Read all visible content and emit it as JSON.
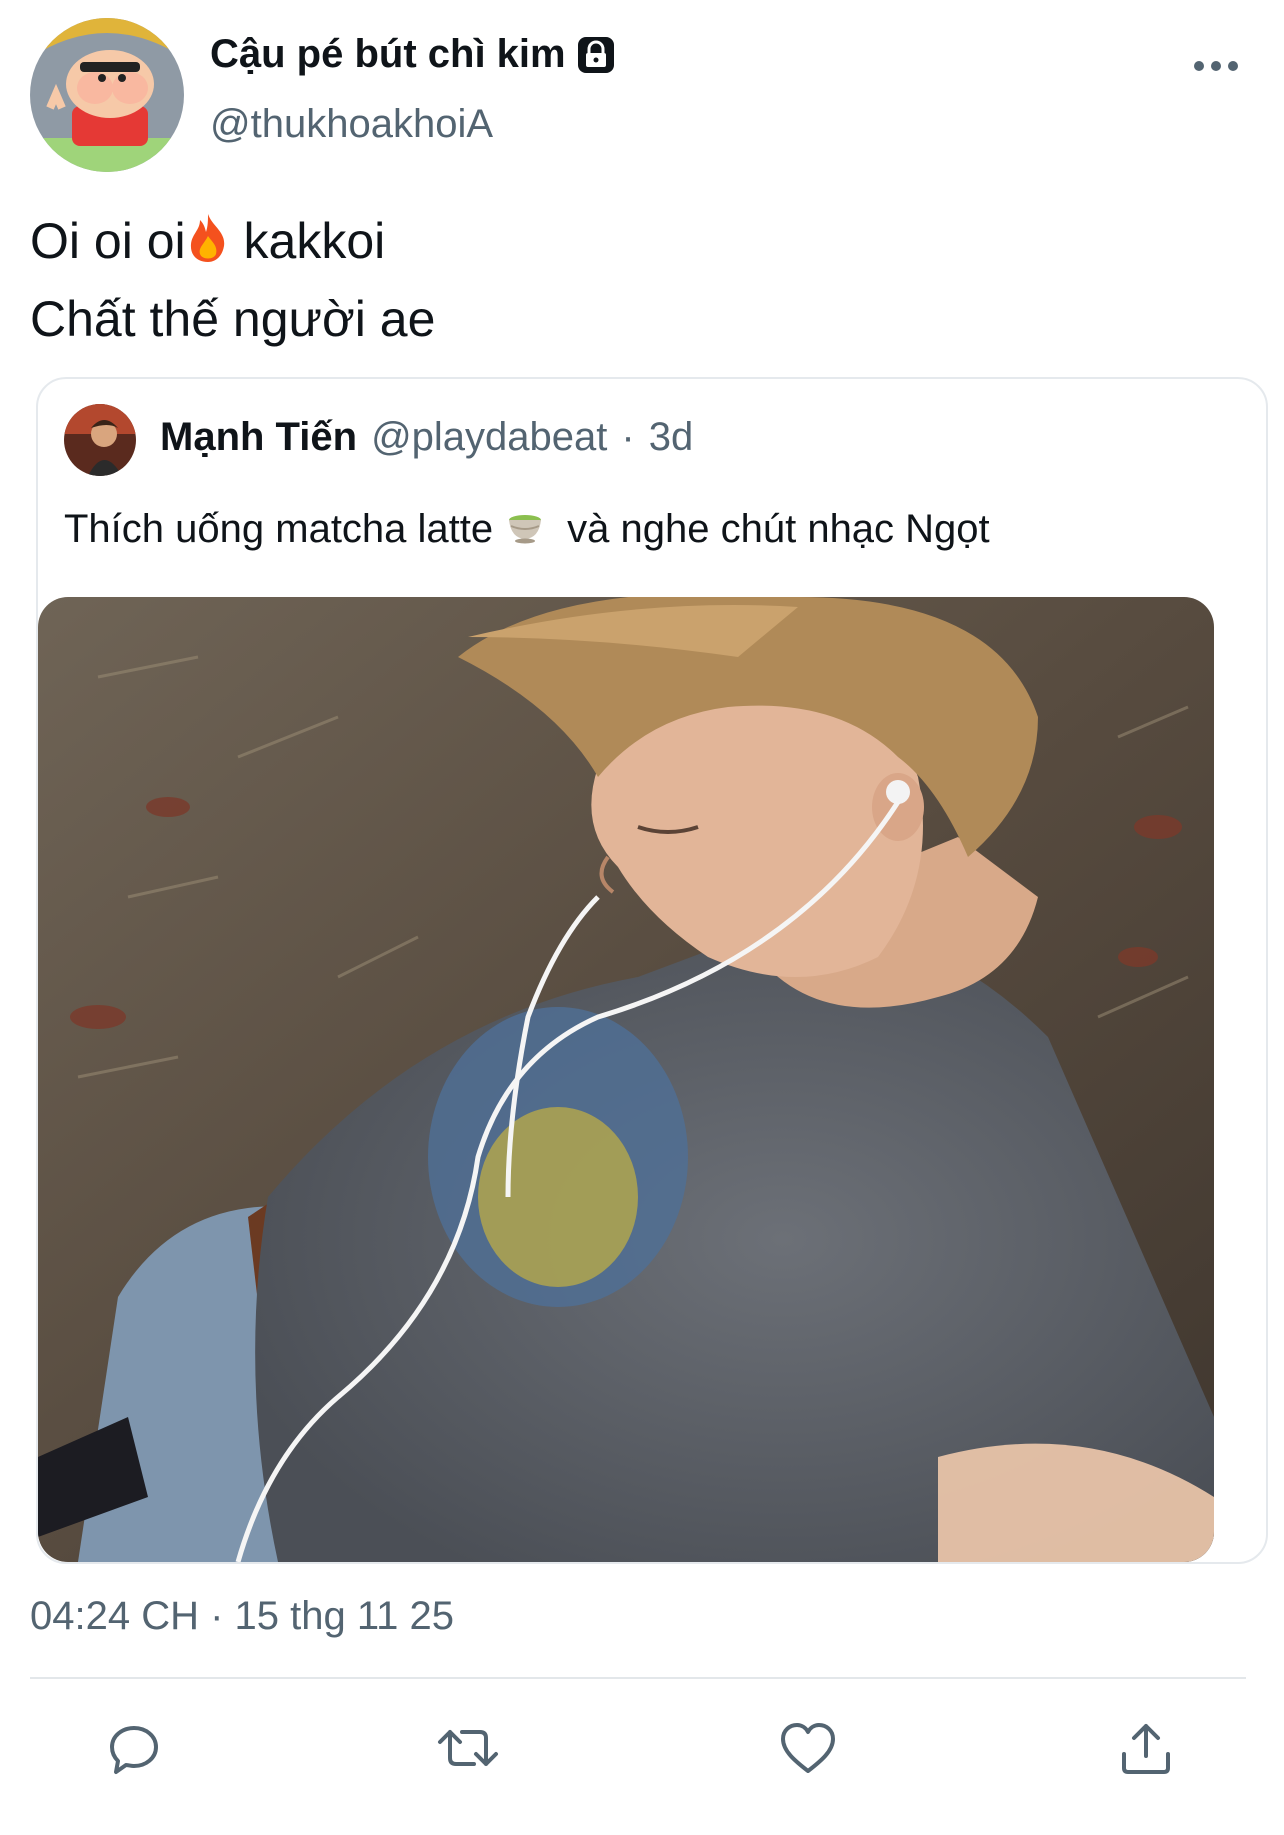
{
  "author": {
    "display_name": "Cậu pé bút chì kim",
    "handle": "@thukhoakhoiA",
    "protected_icon": "lock-icon",
    "avatar_icon": "cartoon-avatar"
  },
  "tweet": {
    "line1_before": "Oi oi oi",
    "line1_emoji": "fire",
    "line1_after": "kakkoi",
    "line2": "Chất thế người ae"
  },
  "quote": {
    "display_name": "Mạnh Tiến",
    "handle": "@playdabeat",
    "separator": "·",
    "time_ago": "3d",
    "text_before": "Thích uống matcha latte",
    "text_emoji": "matcha-tea",
    "text_after": "và nghe chút nhạc Ngọt"
  },
  "meta": {
    "timestamp": "04:24 CH · 15 thg 11 25"
  },
  "actions": [
    "reply-icon",
    "retweet-icon",
    "like-icon",
    "share-icon"
  ],
  "colors": {
    "text": "#0f1419",
    "secondary": "#536471",
    "border": "#e5e9ed"
  }
}
